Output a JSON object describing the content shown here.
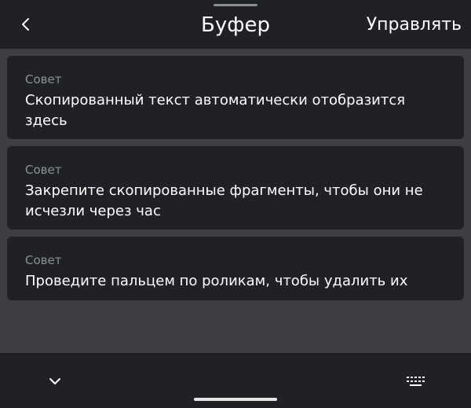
{
  "header": {
    "title": "Буфер",
    "back_icon": "chevron-left-icon",
    "manage_label": "Управлять"
  },
  "tips": [
    {
      "label": "Совет",
      "text": "Скопированный текст автоматически отобразится здесь"
    },
    {
      "label": "Совет",
      "text": "Закрепите скопированные фрагменты, чтобы они не исчезли через час"
    },
    {
      "label": "Совет",
      "text": "Проведите пальцем по роликам, чтобы удалить их"
    }
  ],
  "bottom_bar": {
    "collapse_icon": "chevron-down-icon",
    "keyboard_icon": "keyboard-icon"
  },
  "colors": {
    "background": "#1f2125",
    "list_background": "#3e3f43",
    "label_text": "#8d9096",
    "primary_text": "#ffffff"
  }
}
